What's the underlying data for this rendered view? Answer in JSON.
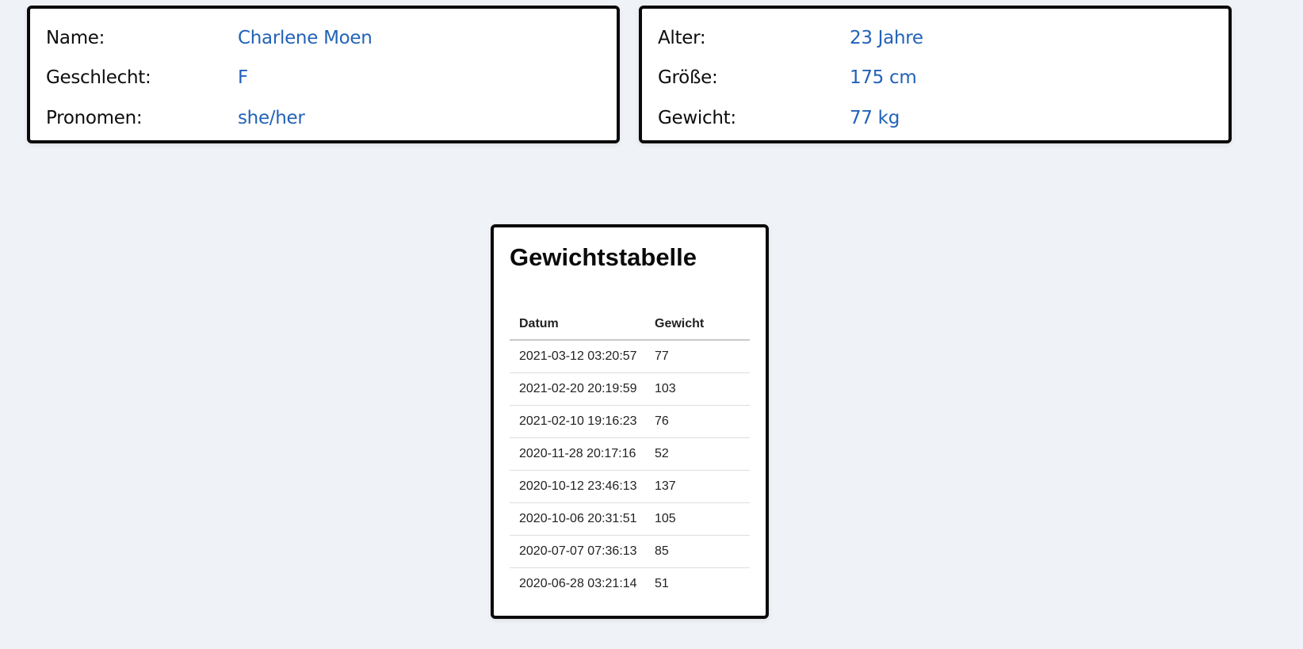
{
  "profile": {
    "left": [
      {
        "label": "Name:",
        "value": "Charlene Moen"
      },
      {
        "label": "Geschlecht:",
        "value": "F"
      },
      {
        "label": "Pronomen:",
        "value": "she/her"
      }
    ],
    "right": [
      {
        "label": "Alter:",
        "value": "23 Jahre"
      },
      {
        "label": "Größe:",
        "value": "175 cm"
      },
      {
        "label": "Gewicht:",
        "value": "77 kg"
      }
    ]
  },
  "weight_table": {
    "title": "Gewichtstabelle",
    "columns": [
      "Datum",
      "Gewicht"
    ],
    "rows": [
      {
        "date": "2021-03-12 03:20:57",
        "weight": "77"
      },
      {
        "date": "2021-02-20 20:19:59",
        "weight": "103"
      },
      {
        "date": "2021-02-10 19:16:23",
        "weight": "76"
      },
      {
        "date": "2020-11-28 20:17:16",
        "weight": "52"
      },
      {
        "date": "2020-10-12 23:46:13",
        "weight": "137"
      },
      {
        "date": "2020-10-06 20:31:51",
        "weight": "105"
      },
      {
        "date": "2020-07-07 07:36:13",
        "weight": "85"
      },
      {
        "date": "2020-06-28 03:21:14",
        "weight": "51"
      }
    ]
  },
  "colors": {
    "background": "#eff2f7",
    "card": "#ffffff",
    "border": "#0a0a0a",
    "value_accent": "#2262b8"
  }
}
